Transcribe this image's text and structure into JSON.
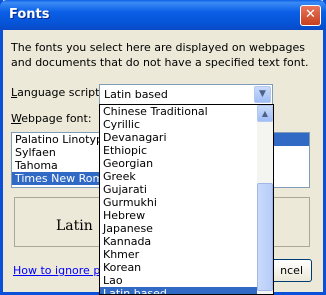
{
  "window": {
    "title": "Fonts",
    "close_glyph": "✕"
  },
  "description": "The fonts you select here are displayed on webpages and documents that do not have a specified text font.",
  "language": {
    "label_accel": "L",
    "label_rest": "anguage script:",
    "value": "Latin based",
    "options": [
      "Chinese Traditional",
      "Cyrillic",
      "Devanagari",
      "Ethiopic",
      "Georgian",
      "Greek",
      "Gujarati",
      "Gurmukhi",
      "Hebrew",
      "Japanese",
      "Kannada",
      "Khmer",
      "Korean",
      "Lao",
      "Latin based"
    ],
    "selected_index": 14
  },
  "webpage_font": {
    "label_accel": "W",
    "label_rest": "ebpage font:",
    "items": [
      "Palatino Linotype",
      "Sylfaen",
      "Tahoma",
      "Times New Roman"
    ],
    "selected_index": 3
  },
  "sample_text": "Latin",
  "link_text": "How to ignore pre",
  "cancel_label": "ncel",
  "icons": {
    "dropdown": "chevron-down-icon",
    "scroll_up": "scroll-up-icon",
    "scroll_down": "scroll-down-icon",
    "close": "close-icon"
  }
}
